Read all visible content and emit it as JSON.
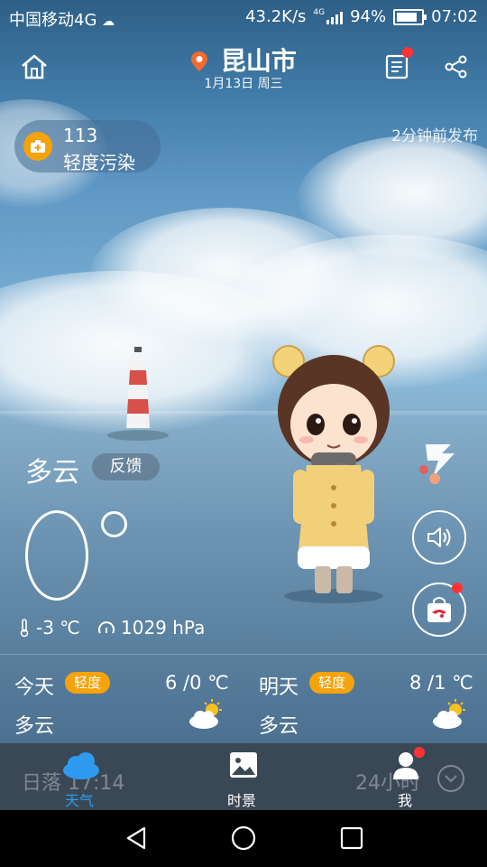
{
  "status_bar": {
    "carrier": "中国移动4G",
    "network_speed": "43.2K/s",
    "network_type": "4G",
    "battery": "94%",
    "time": "07:02"
  },
  "header": {
    "city": "昆山市",
    "date": "1月13日 周三",
    "icons": [
      "home-icon",
      "location-pin-icon",
      "news-icon",
      "share-icon"
    ]
  },
  "aqi": {
    "value": "113",
    "level": "轻度污染"
  },
  "publish_time": "2分钟前发布",
  "current": {
    "condition": "多云",
    "feedback_label": "反馈",
    "body_temp": "-3 ℃",
    "pressure": "1029 hPa"
  },
  "forecast": {
    "today": {
      "label": "今天",
      "aqi_level": "轻度",
      "range": "6 /0 ℃",
      "condition": "多云"
    },
    "tomorrow": {
      "label": "明天",
      "aqi_level": "轻度",
      "range": "8 /1 ℃",
      "condition": "多云"
    }
  },
  "bottom_nav": {
    "ghost_left": "日落 17:14",
    "ghost_right": "24小时",
    "items": [
      {
        "label": "天气"
      },
      {
        "label": "时景"
      },
      {
        "label": "我"
      }
    ]
  },
  "colors": {
    "accent_blue": "#2e9bf0",
    "aqi_orange": "#f5a30a",
    "badge_red": "#ff3333",
    "nav_bg": "#3a4856"
  }
}
